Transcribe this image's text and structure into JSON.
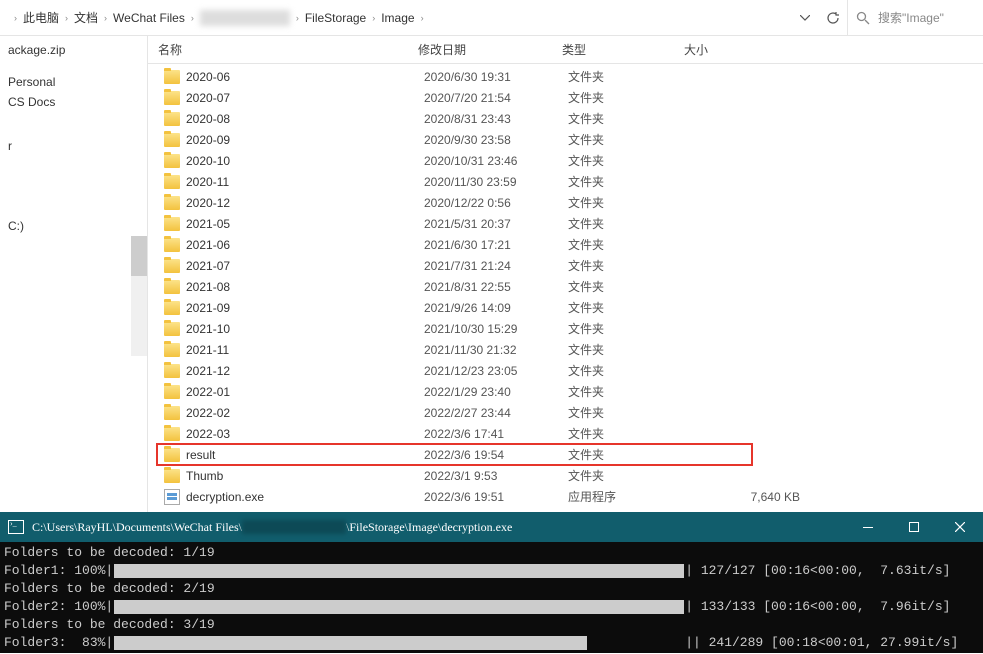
{
  "breadcrumb": [
    "此电脑",
    "文档",
    "WeChat Files",
    "[blur]",
    "FileStorage",
    "Image"
  ],
  "search": {
    "placeholder": "搜索\"Image\""
  },
  "sidebar": {
    "items": [
      "ackage.zip",
      "",
      "Personal",
      "CS Docs",
      "",
      "",
      "r",
      "",
      "",
      "",
      "",
      "",
      "C:)"
    ]
  },
  "columns": {
    "name": "名称",
    "date": "修改日期",
    "type": "类型",
    "size": "大小"
  },
  "files": [
    {
      "name": "2020-06",
      "date": "2020/6/30 19:31",
      "type": "文件夹",
      "size": "",
      "icon": "folder"
    },
    {
      "name": "2020-07",
      "date": "2020/7/20 21:54",
      "type": "文件夹",
      "size": "",
      "icon": "folder"
    },
    {
      "name": "2020-08",
      "date": "2020/8/31 23:43",
      "type": "文件夹",
      "size": "",
      "icon": "folder"
    },
    {
      "name": "2020-09",
      "date": "2020/9/30 23:58",
      "type": "文件夹",
      "size": "",
      "icon": "folder"
    },
    {
      "name": "2020-10",
      "date": "2020/10/31 23:46",
      "type": "文件夹",
      "size": "",
      "icon": "folder"
    },
    {
      "name": "2020-11",
      "date": "2020/11/30 23:59",
      "type": "文件夹",
      "size": "",
      "icon": "folder"
    },
    {
      "name": "2020-12",
      "date": "2020/12/22 0:56",
      "type": "文件夹",
      "size": "",
      "icon": "folder"
    },
    {
      "name": "2021-05",
      "date": "2021/5/31 20:37",
      "type": "文件夹",
      "size": "",
      "icon": "folder"
    },
    {
      "name": "2021-06",
      "date": "2021/6/30 17:21",
      "type": "文件夹",
      "size": "",
      "icon": "folder"
    },
    {
      "name": "2021-07",
      "date": "2021/7/31 21:24",
      "type": "文件夹",
      "size": "",
      "icon": "folder"
    },
    {
      "name": "2021-08",
      "date": "2021/8/31 22:55",
      "type": "文件夹",
      "size": "",
      "icon": "folder"
    },
    {
      "name": "2021-09",
      "date": "2021/9/26 14:09",
      "type": "文件夹",
      "size": "",
      "icon": "folder"
    },
    {
      "name": "2021-10",
      "date": "2021/10/30 15:29",
      "type": "文件夹",
      "size": "",
      "icon": "folder"
    },
    {
      "name": "2021-11",
      "date": "2021/11/30 21:32",
      "type": "文件夹",
      "size": "",
      "icon": "folder"
    },
    {
      "name": "2021-12",
      "date": "2021/12/23 23:05",
      "type": "文件夹",
      "size": "",
      "icon": "folder"
    },
    {
      "name": "2022-01",
      "date": "2022/1/29 23:40",
      "type": "文件夹",
      "size": "",
      "icon": "folder"
    },
    {
      "name": "2022-02",
      "date": "2022/2/27 23:44",
      "type": "文件夹",
      "size": "",
      "icon": "folder"
    },
    {
      "name": "2022-03",
      "date": "2022/3/6 17:41",
      "type": "文件夹",
      "size": "",
      "icon": "folder"
    },
    {
      "name": "result",
      "date": "2022/3/6 19:54",
      "type": "文件夹",
      "size": "",
      "icon": "folder",
      "highlight": true
    },
    {
      "name": "Thumb",
      "date": "2022/3/1 9:53",
      "type": "文件夹",
      "size": "",
      "icon": "folder"
    },
    {
      "name": "decryption.exe",
      "date": "2022/3/6 19:51",
      "type": "应用程序",
      "size": "7,640 KB",
      "icon": "exe"
    }
  ],
  "terminal": {
    "title_prefix": "C:\\Users\\RayHL\\Documents\\WeChat Files\\",
    "title_suffix": "\\FileStorage\\Image\\decryption.exe",
    "lines": [
      {
        "text": "Folders to be decoded: 1/19"
      },
      {
        "text": "Folder1: 100%",
        "bar_pct": 100,
        "stats": " 127/127 [00:16<00:00,  7.63it/s]"
      },
      {
        "text": "Folders to be decoded: 2/19"
      },
      {
        "text": "Folder2: 100%",
        "bar_pct": 100,
        "stats": " 133/133 [00:16<00:00,  7.96it/s]"
      },
      {
        "text": "Folders to be decoded: 3/19"
      },
      {
        "text": "Folder3:  83%",
        "bar_pct": 83,
        "stats": "| 241/289 [00:18<00:01, 27.99it/s]"
      }
    ]
  }
}
